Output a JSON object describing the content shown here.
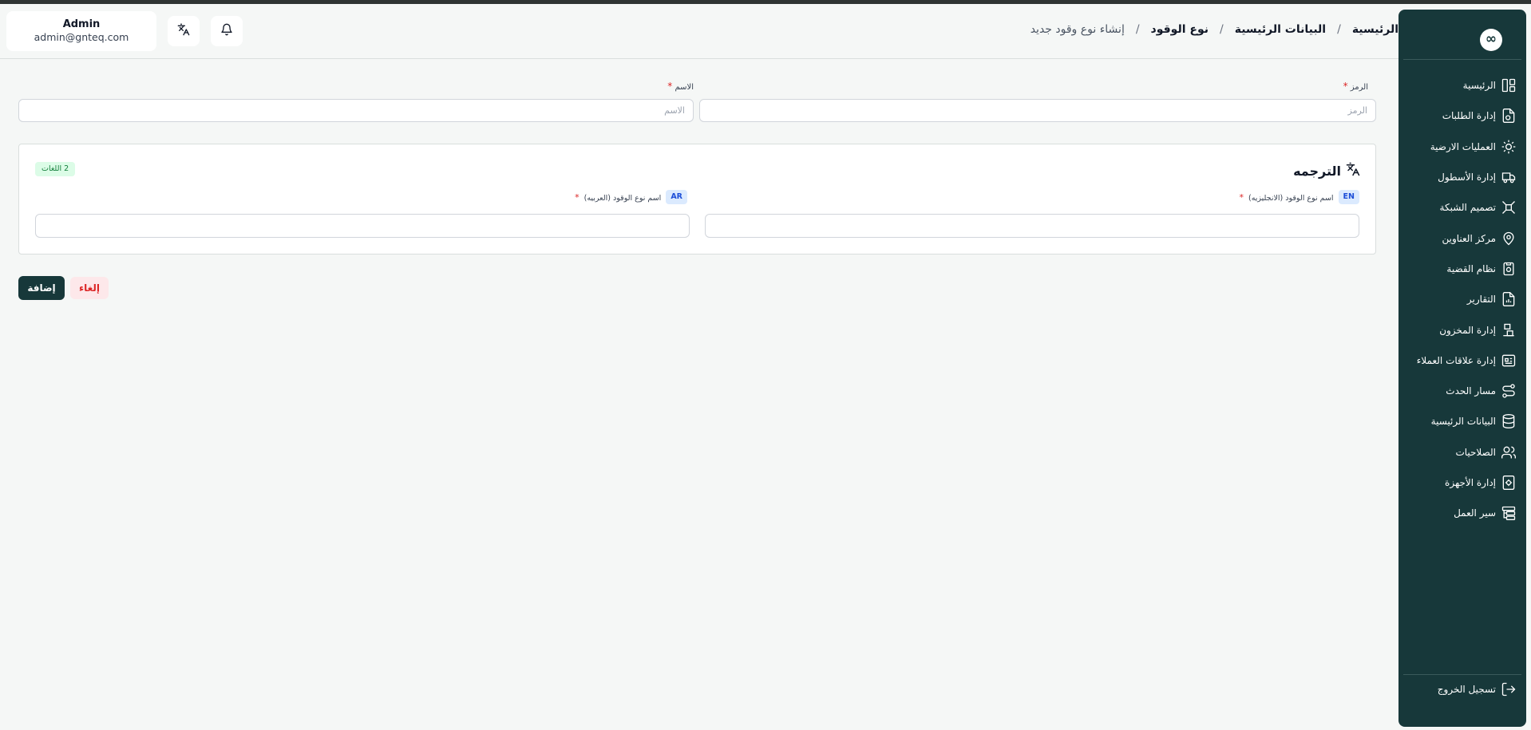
{
  "header": {
    "user": {
      "name": "Admin",
      "email": "admin@gnteq.com"
    },
    "breadcrumb": [
      {
        "label": "الرئيسية"
      },
      {
        "label": "البيانات الرئيسية"
      },
      {
        "label": "نوع الوقود"
      },
      {
        "label": "إنشاء نوع وقود جديد"
      }
    ],
    "separator": "/"
  },
  "sidebar": {
    "logo_glyph": "∞",
    "items": [
      {
        "label": "الرئيسية",
        "icon": "dashboard-icon"
      },
      {
        "label": "إدارة الطلبات",
        "icon": "orders-icon"
      },
      {
        "label": "العمليات الارضية",
        "icon": "ground-ops-icon"
      },
      {
        "label": "إدارة الأسطول",
        "icon": "truck-icon"
      },
      {
        "label": "تصميم الشبكة",
        "icon": "network-icon"
      },
      {
        "label": "مركز العناوين",
        "icon": "location-icon"
      },
      {
        "label": "نظام القضية",
        "icon": "case-icon"
      },
      {
        "label": "التقارير",
        "icon": "report-icon"
      },
      {
        "label": "إدارة المخزون",
        "icon": "inventory-icon"
      },
      {
        "label": "إدارة علاقات العملاء",
        "icon": "crm-icon"
      },
      {
        "label": "مسار الحدث",
        "icon": "route-icon"
      },
      {
        "label": "البيانات الرئيسية",
        "icon": "database-icon"
      },
      {
        "label": "الصلاحيات",
        "icon": "users-icon"
      },
      {
        "label": "إدارة الأجهزة",
        "icon": "device-gear-icon"
      },
      {
        "label": "سير العمل",
        "icon": "workflow-icon"
      }
    ],
    "logout_label": "تسجيل الخروج"
  },
  "form": {
    "code": {
      "label": "الرمز",
      "placeholder": "الرمز",
      "value": ""
    },
    "name": {
      "label": "الاسم",
      "placeholder": "الاسم",
      "value": ""
    },
    "required_mark": "*"
  },
  "translation": {
    "title": "الترجمه",
    "badge": "2 اللغات",
    "en": {
      "chip": "EN",
      "label": "اسم نوع الوقود (الانجليزيه)"
    },
    "ar": {
      "chip": "AR",
      "label": "اسم نوع الوقود (العربيه)"
    }
  },
  "actions": {
    "add": "إضافة",
    "cancel": "إلغاء"
  },
  "colors": {
    "sidebar_bg": "#17383a",
    "primary": "#17383a",
    "danger": "#dc2626",
    "badge_green": "#15803d",
    "chip_blue": "#1d4ed8"
  }
}
